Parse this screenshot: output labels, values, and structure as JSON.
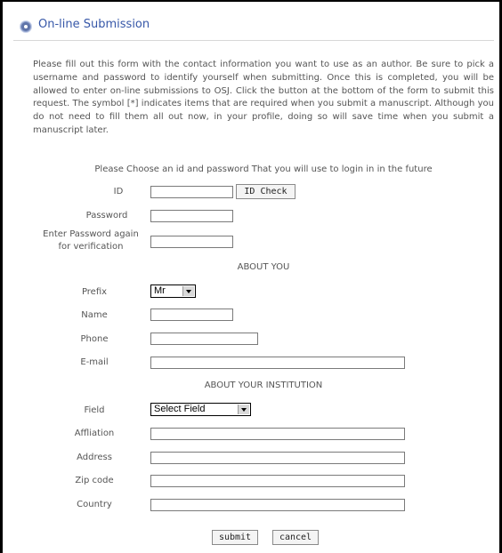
{
  "header": {
    "title": "On-line Submission"
  },
  "intro": "Please fill out this form with the contact information you want to use as an author. Be sure to pick a username and password to identify yourself when submitting. Once this is completed, you will be allowed to enter on-line submissions to OSJ. Click the button at the bottom of the form to submit this request. The symbol [*] indicates items that are required when you submit a manuscript. Although you do not need to fill them all out now, in your profile, doing so will save time when you submit a manuscript later.",
  "login": {
    "caption": "Please Choose an id and password That you will use to login in in the future",
    "id_label": "ID",
    "id_check_label": "ID Check",
    "password_label": "Password",
    "password_again_label_1": "Enter Password again",
    "password_again_label_2": "for verification"
  },
  "about_you": {
    "caption": "ABOUT YOU",
    "prefix_label": "Prefix",
    "prefix_value": "Mr",
    "name_label": "Name",
    "phone_label": "Phone",
    "email_label": "E-mail"
  },
  "institution": {
    "caption": "ABOUT YOUR INSTITUTION",
    "field_label": "Field",
    "field_value": "Select Field",
    "affiliation_label": "Affliation",
    "address_label": "Address",
    "zip_label": "Zip code",
    "country_label": "Country"
  },
  "actions": {
    "submit_label": "submit",
    "cancel_label": "cancel"
  }
}
